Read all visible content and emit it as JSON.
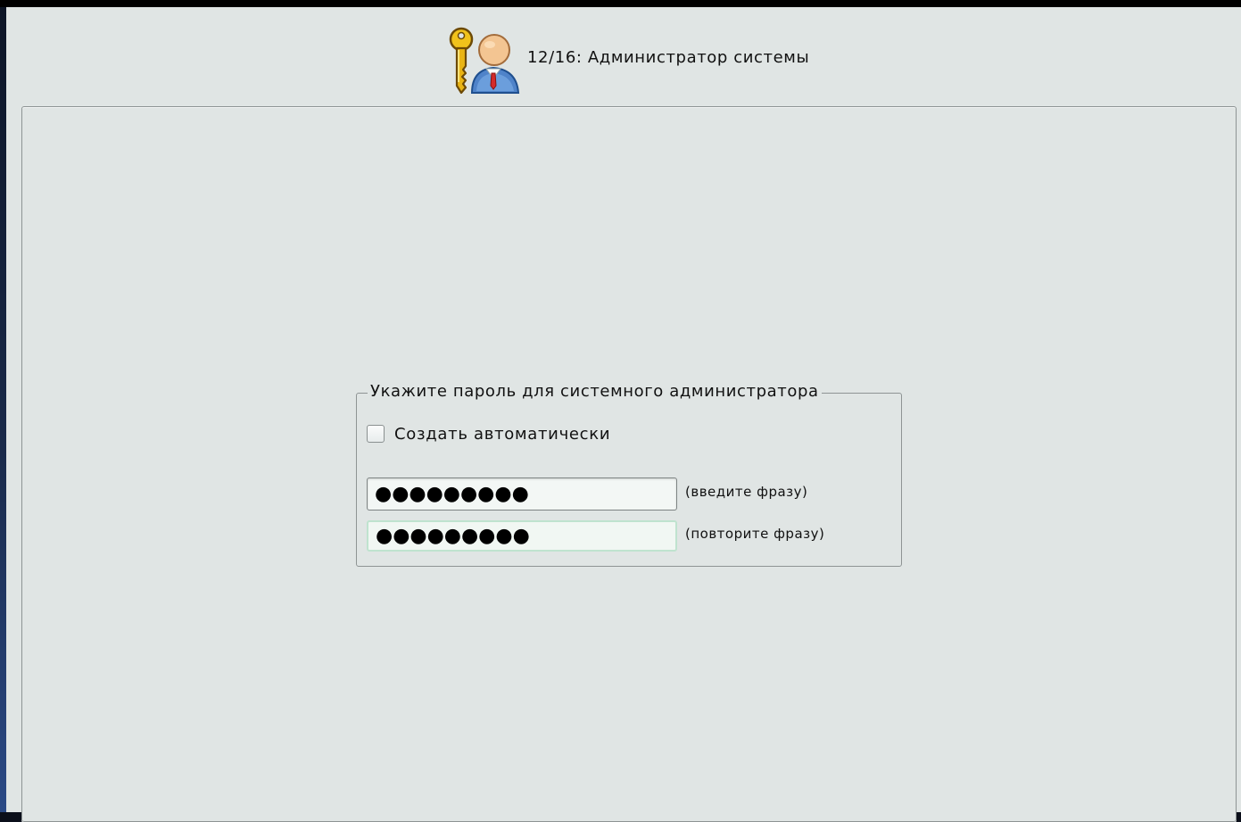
{
  "header": {
    "icon": "key-user-icon",
    "title": "12/16: Администратор системы"
  },
  "password_group": {
    "legend": "Укажите пароль для системного администратора",
    "auto_checkbox": {
      "label": "Создать автоматически",
      "checked": false
    },
    "password_field": {
      "value": "●●●●●●●●●",
      "hint": "(введите фразу)"
    },
    "confirm_field": {
      "value": "●●●●●●●●●",
      "hint": "(повторите фразу)"
    }
  },
  "colors": {
    "window_background": "#e0e5e4",
    "confirm_field_focus_border": "#bfe3cf"
  }
}
